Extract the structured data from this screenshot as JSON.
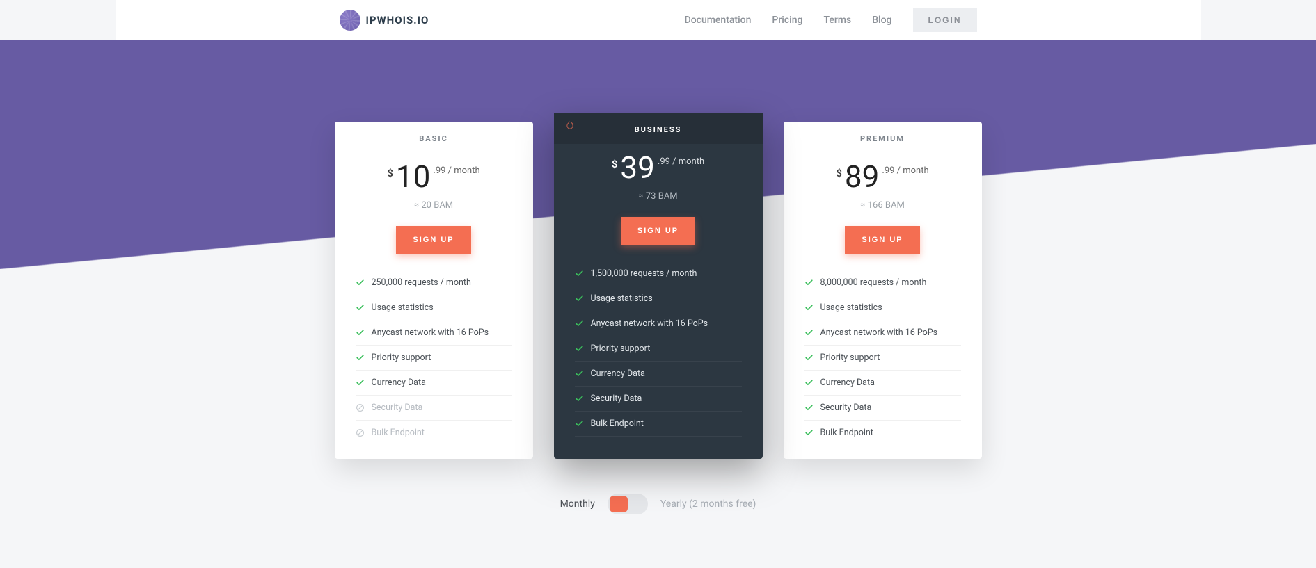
{
  "brand": "IPWHOIS.IO",
  "nav": {
    "items": [
      "Documentation",
      "Pricing",
      "Terms",
      "Blog"
    ],
    "login": "Login"
  },
  "toggle": {
    "left": "Monthly",
    "right": "Yearly (2 months free)"
  },
  "plans": [
    {
      "title": "Basic",
      "currency": "$",
      "price": "10",
      "sub": ".99 / month",
      "approx": "≈ 20 BAM",
      "button": "Sign Up",
      "features": [
        {
          "text": "250,000 requests / month",
          "ok": true
        },
        {
          "text": "Usage statistics",
          "ok": true
        },
        {
          "text": "Anycast network with 16 PoPs",
          "ok": true
        },
        {
          "text": "Priority support",
          "ok": true
        },
        {
          "text": "Currency Data",
          "ok": true
        },
        {
          "text": "Security Data",
          "ok": false
        },
        {
          "text": "Bulk Endpoint",
          "ok": false
        }
      ]
    },
    {
      "title": "Business",
      "currency": "$",
      "price": "39",
      "sub": ".99 / month",
      "approx": "≈ 73 BAM",
      "button": "Sign Up",
      "features": [
        {
          "text": "1,500,000 requests / month",
          "ok": true
        },
        {
          "text": "Usage statistics",
          "ok": true
        },
        {
          "text": "Anycast network with 16 PoPs",
          "ok": true
        },
        {
          "text": "Priority support",
          "ok": true
        },
        {
          "text": "Currency Data",
          "ok": true
        },
        {
          "text": "Security Data",
          "ok": true
        },
        {
          "text": "Bulk Endpoint",
          "ok": true
        }
      ]
    },
    {
      "title": "Premium",
      "currency": "$",
      "price": "89",
      "sub": ".99 / month",
      "approx": "≈ 166 BAM",
      "button": "Sign Up",
      "features": [
        {
          "text": "8,000,000 requests / month",
          "ok": true
        },
        {
          "text": "Usage statistics",
          "ok": true
        },
        {
          "text": "Anycast network with 16 PoPs",
          "ok": true
        },
        {
          "text": "Priority support",
          "ok": true
        },
        {
          "text": "Currency Data",
          "ok": true
        },
        {
          "text": "Security Data",
          "ok": true
        },
        {
          "text": "Bulk Endpoint",
          "ok": true
        }
      ]
    }
  ]
}
